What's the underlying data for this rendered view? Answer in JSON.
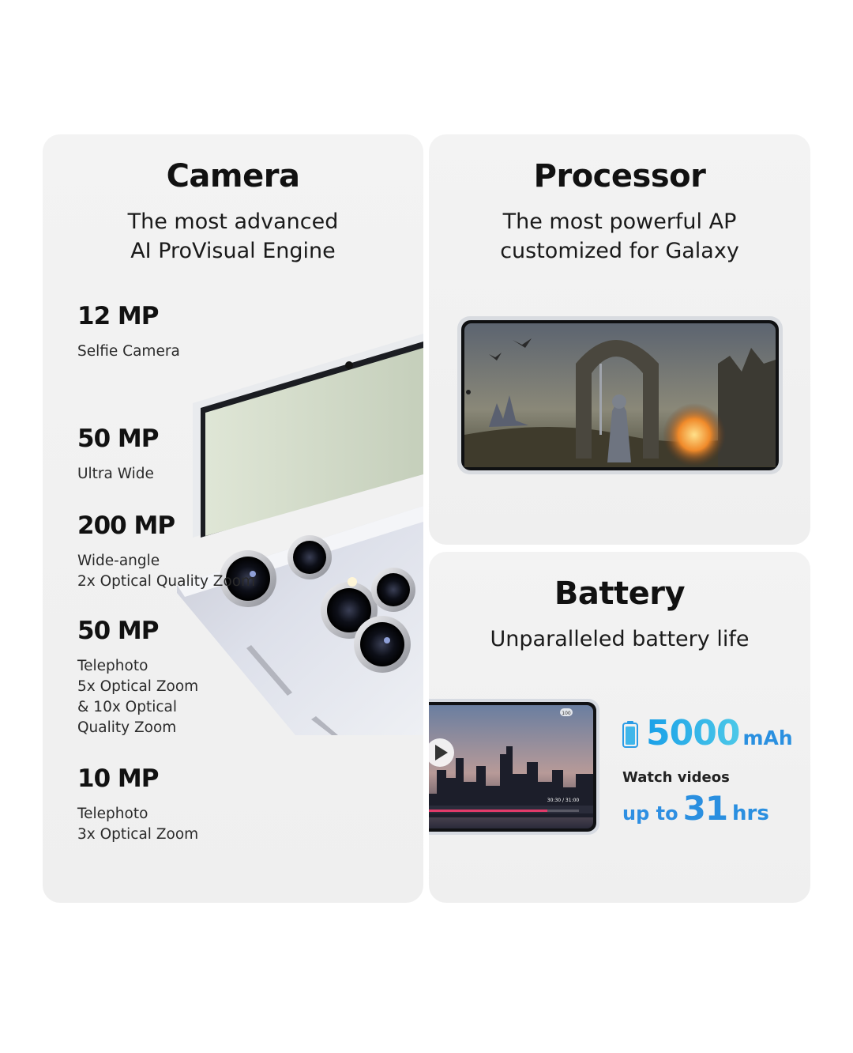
{
  "camera": {
    "title": "Camera",
    "subtitle_lines": [
      "The most advanced",
      "AI ProVisual Engine"
    ],
    "specs": [
      {
        "value": "12 MP",
        "desc_lines": [
          "Selfie Camera"
        ]
      },
      {
        "value": "50 MP",
        "desc_lines": [
          "Ultra Wide"
        ]
      },
      {
        "value": "200 MP",
        "desc_lines": [
          "Wide-angle",
          "2x Optical Quality Zoom"
        ]
      },
      {
        "value": "50 MP",
        "desc_lines": [
          "Telephoto",
          "5x Optical Zoom",
          "& 10x Optical",
          "Quality Zoom"
        ]
      },
      {
        "value": "10 MP",
        "desc_lines": [
          "Telephoto",
          "3x Optical Zoom"
        ]
      }
    ]
  },
  "processor": {
    "title": "Processor",
    "subtitle_lines": [
      "The most powerful AP",
      "customized for Galaxy"
    ]
  },
  "battery": {
    "title": "Battery",
    "subtitle": "Unparalleled battery life",
    "capacity": "5000",
    "capacity_unit": "mAh",
    "watch_label": "Watch videos",
    "up_to": "up to",
    "hours": "31",
    "hours_unit": "hrs",
    "video_badge": "100",
    "video_time": "30:30 / 31:00"
  },
  "colors": {
    "card_bg": "#f1f1f1",
    "accent_blue": "#2a8fe0",
    "accent_cyan": "#4cc8e8"
  }
}
